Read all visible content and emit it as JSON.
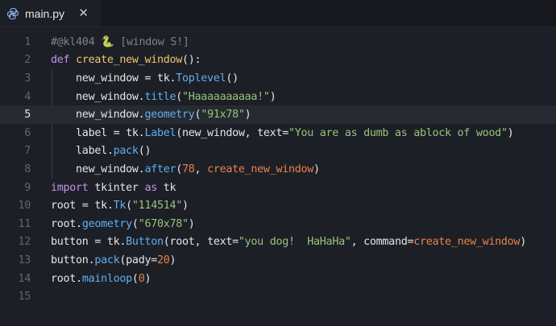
{
  "tab": {
    "filename": "main.py",
    "close_glyph": "✕",
    "icon": "python-icon"
  },
  "active_line": 5,
  "lines": [
    {
      "num": "1",
      "tokens": [
        [
          "c",
          "#@kl404 "
        ],
        [
          "c",
          "🐍"
        ],
        [
          "c",
          " [window S!]"
        ]
      ]
    },
    {
      "num": "2",
      "tokens": [
        [
          "k",
          "def "
        ],
        [
          "f",
          "create_new_window"
        ],
        [
          "v",
          "():"
        ]
      ]
    },
    {
      "num": "3",
      "tokens": [
        [
          "v",
          "    new_window = tk."
        ],
        [
          "m",
          "Toplevel"
        ],
        [
          "v",
          "()"
        ]
      ]
    },
    {
      "num": "4",
      "tokens": [
        [
          "v",
          "    new_window."
        ],
        [
          "m",
          "title"
        ],
        [
          "v",
          "("
        ],
        [
          "s",
          "\"Haaaaaaaaaa!\""
        ],
        [
          "v",
          ")"
        ]
      ]
    },
    {
      "num": "5",
      "tokens": [
        [
          "v",
          "    new_window."
        ],
        [
          "m",
          "geometry"
        ],
        [
          "v",
          "("
        ],
        [
          "s",
          "\"91x78\""
        ],
        [
          "v",
          ")"
        ]
      ]
    },
    {
      "num": "6",
      "tokens": [
        [
          "v",
          "    label = tk."
        ],
        [
          "m",
          "Label"
        ],
        [
          "v",
          "(new_window, text="
        ],
        [
          "s",
          "\"You are as dumb as ablock of wood\""
        ],
        [
          "v",
          ")"
        ]
      ]
    },
    {
      "num": "7",
      "tokens": [
        [
          "v",
          "    label."
        ],
        [
          "m",
          "pack"
        ],
        [
          "v",
          "()"
        ]
      ]
    },
    {
      "num": "8",
      "tokens": [
        [
          "v",
          "    new_window."
        ],
        [
          "m",
          "after"
        ],
        [
          "v",
          "("
        ],
        [
          "n",
          "78"
        ],
        [
          "v",
          ", "
        ],
        [
          "n",
          "create_new_window"
        ],
        [
          "v",
          ")"
        ]
      ]
    },
    {
      "num": "9",
      "tokens": [
        [
          "k",
          "import "
        ],
        [
          "v",
          "tkinter "
        ],
        [
          "k",
          "as "
        ],
        [
          "v",
          "tk"
        ]
      ]
    },
    {
      "num": "10",
      "tokens": [
        [
          "v",
          "root = tk."
        ],
        [
          "m",
          "Tk"
        ],
        [
          "v",
          "("
        ],
        [
          "s",
          "\"114514\""
        ],
        [
          "v",
          ")"
        ]
      ]
    },
    {
      "num": "11",
      "tokens": [
        [
          "v",
          "root."
        ],
        [
          "m",
          "geometry"
        ],
        [
          "v",
          "("
        ],
        [
          "s",
          "\"670x78\""
        ],
        [
          "v",
          ")"
        ]
      ]
    },
    {
      "num": "12",
      "tokens": [
        [
          "v",
          "button = tk."
        ],
        [
          "m",
          "Button"
        ],
        [
          "v",
          "(root, text="
        ],
        [
          "s",
          "\"you dog!  HaHaHa\""
        ],
        [
          "v",
          ", command="
        ],
        [
          "n",
          "create_new_window"
        ],
        [
          "v",
          ")"
        ]
      ]
    },
    {
      "num": "13",
      "tokens": [
        [
          "v",
          "button."
        ],
        [
          "m",
          "pack"
        ],
        [
          "v",
          "(pady="
        ],
        [
          "n",
          "20"
        ],
        [
          "v",
          ")"
        ]
      ]
    },
    {
      "num": "14",
      "tokens": [
        [
          "v",
          "root."
        ],
        [
          "m",
          "mainloop"
        ],
        [
          "v",
          "("
        ],
        [
          "n",
          "0"
        ],
        [
          "v",
          ")"
        ]
      ]
    },
    {
      "num": "15",
      "tokens": []
    }
  ]
}
